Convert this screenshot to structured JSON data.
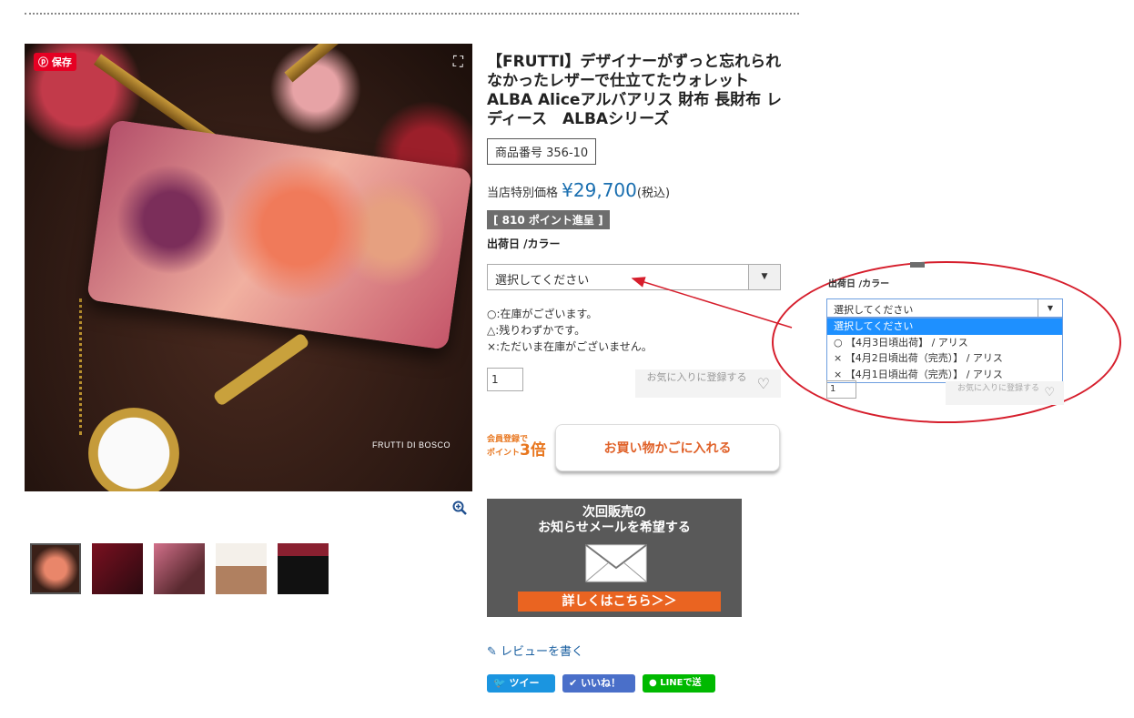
{
  "product": {
    "title": "【FRUTTI】デザイナーがずっと忘れられなかったレザーで仕立てたウォレット ALBA Aliceアルバアリス 財布 長財布 レディース　ALBAシリーズ",
    "sku": "商品番号 356-10",
    "price_label": "当店特別価格",
    "price": "¥29,700",
    "tax": "(税込)",
    "points": "[ 810 ポイント進呈 ]",
    "variant_label": "出荷日 /カラー",
    "select_placeholder": "選択してください",
    "stock_legend": [
      "○:在庫がございます。",
      "△:残りわずかです。",
      "×:ただいま在庫がございません。"
    ],
    "quantity": "1",
    "favorite_label": "お気に入りに登録する",
    "promo_line1": "会員登録で",
    "promo_line2": "ポイント",
    "promo_big": "3倍",
    "cart_button": "お買い物かごに入れる"
  },
  "image": {
    "pinterest_save": "保存",
    "brand_watermark": "FRUTTI DI BOSCO"
  },
  "notify": {
    "line1": "次回販売の",
    "line2": "お知らせメールを希望する",
    "button": "詳しくはこちら＞＞"
  },
  "review_link": "レビューを書く",
  "social": {
    "tweet": "ツイート",
    "like": "いいね！",
    "line": "LINEで送る"
  },
  "callout": {
    "label": "出荷日 /カラー",
    "select_text": "選択してください",
    "options": [
      "選択してください",
      "○ 【4月3日頃出荷】 / アリス",
      "× 【4月2日頃出荷（完売）】 / アリス",
      "× 【4月1日頃出荷（完売）】 / アリス"
    ],
    "quantity": "1",
    "favorite_label": "お気に入りに登録する"
  },
  "colors": {
    "price_blue": "#1a6fb0",
    "accent_orange": "#ea6421",
    "callout_red": "#d61e2c",
    "twitter": "#1b95e0",
    "facebook": "#4a6fc9",
    "line": "#00b900"
  }
}
